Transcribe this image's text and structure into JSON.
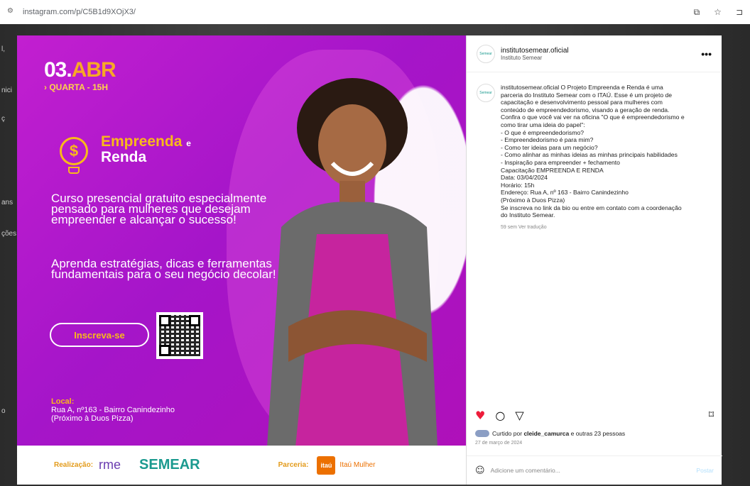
{
  "browser": {
    "url": "instagram.com/p/C5B1d9XOjX3/"
  },
  "background": {
    "side_labels": [
      "l,",
      "nici",
      "ç",
      "ans",
      "ções",
      "o"
    ]
  },
  "flyer": {
    "date_day": "03.",
    "date_month": "ABR",
    "daytime": "› QUARTA - 15H",
    "brand_line1": "Empreenda",
    "brand_conj": "e",
    "brand_line2": "Renda",
    "course": "Curso presencial gratuito especialmente pensado para mulheres que desejam empreender e alcançar o sucesso!",
    "learn": "Aprenda estratégias, dicas e ferramentas fundamentais para o seu negócio decolar!",
    "cta": "Inscreva-se",
    "local_label": "Local:",
    "local_line1": "Rua A, nº163 - Bairro Canindezinho",
    "local_line2": "(Próximo à Duos Pizza)",
    "footer": {
      "realizacao": "Realização:",
      "rme": "rme",
      "semear": "SEMEAR",
      "parceria": "Parceria:",
      "itau": "itaú",
      "itau_mulher": "Itaú Mulher"
    }
  },
  "panel": {
    "username": "institutosemear.oficial",
    "subtitle": "Instituto Semear",
    "more": "•••",
    "avatar_text": "Semear",
    "caption_lines": [
      "institutosemear.oficial O Projeto Empreenda e Renda é uma",
      "parceria do Instituto Semear com o ITAÚ. Esse é um projeto de",
      "capacitação e desenvolvimento pessoal para mulheres com",
      "conteúdo de empreendedorismo, visando a geração de renda.",
      "Confira o que você vai ver na oficina \"O que é empreendedorismo e",
      "como tirar uma ideia do papel\":",
      "- O que é empreendedorismo?",
      "- Empreendedorismo é para mim?",
      "- Como ter ideias para um negócio?",
      "- Como alinhar as minhas ideias as minhas principais habilidades",
      "- Inspiração para empreender + fechamento",
      "Capacitação EMPREENDA E RENDA",
      "Data: 03/04/2024",
      "Horário: 15h",
      "Endereço: Rua A, nº 163 - Bairro Canindezinho",
      "(Próximo à Duos Pizza)",
      "Se inscreva no link da bio ou entre em contato com a coordenação",
      "do Instituto Semear."
    ],
    "caption_meta": "59 sem   Ver tradução",
    "liked_prefix": "Curtido por",
    "liked_user": "cleide_camurca",
    "liked_suffix": "e outras 23 pessoas",
    "post_date": "27 de março de 2024",
    "comment_placeholder": "Adicione um comentário...",
    "post_button": "Postar"
  }
}
